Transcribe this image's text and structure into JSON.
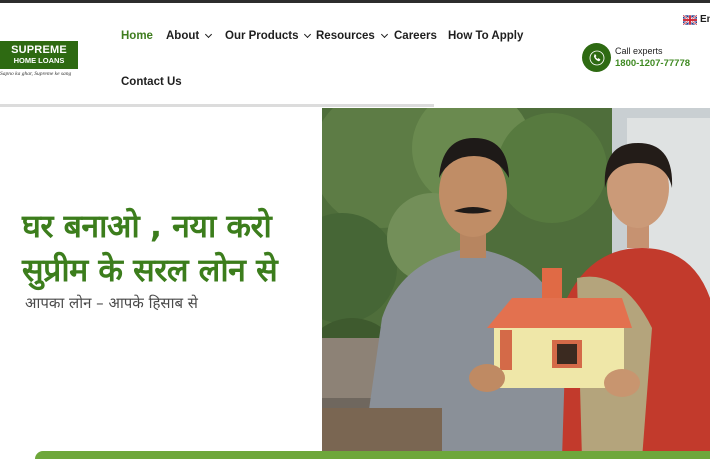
{
  "brand": {
    "name_line1": "SUPREME",
    "name_line2": "HOME LOANS",
    "tagline": "Sapno ka ghar, Supreme ke sang",
    "color": "#2e6a12"
  },
  "nav": {
    "items": [
      {
        "label": "Home",
        "active": true
      },
      {
        "label": "About",
        "dropdown": true
      },
      {
        "label": "Our Products",
        "dropdown": true
      },
      {
        "label": "Resources",
        "dropdown": true
      },
      {
        "label": "Careers"
      },
      {
        "label": "How To Apply"
      },
      {
        "label": "Contact Us"
      }
    ],
    "active_color": "#3f7d1f"
  },
  "language": {
    "label": "En",
    "flag_icon": "uk-flag-icon"
  },
  "call": {
    "label": "Call experts",
    "number": "1800-1207-77778",
    "icon": "phone-icon"
  },
  "hero": {
    "headline_line1": "घर बनाओ , नया करो",
    "headline_line2": "सुप्रीम के सरल लोन से",
    "subline": "आपका लोन – आपके हिसाब से",
    "headline_color": "#3c7d1c",
    "image": "smiling-couple-holding-toy-house"
  }
}
